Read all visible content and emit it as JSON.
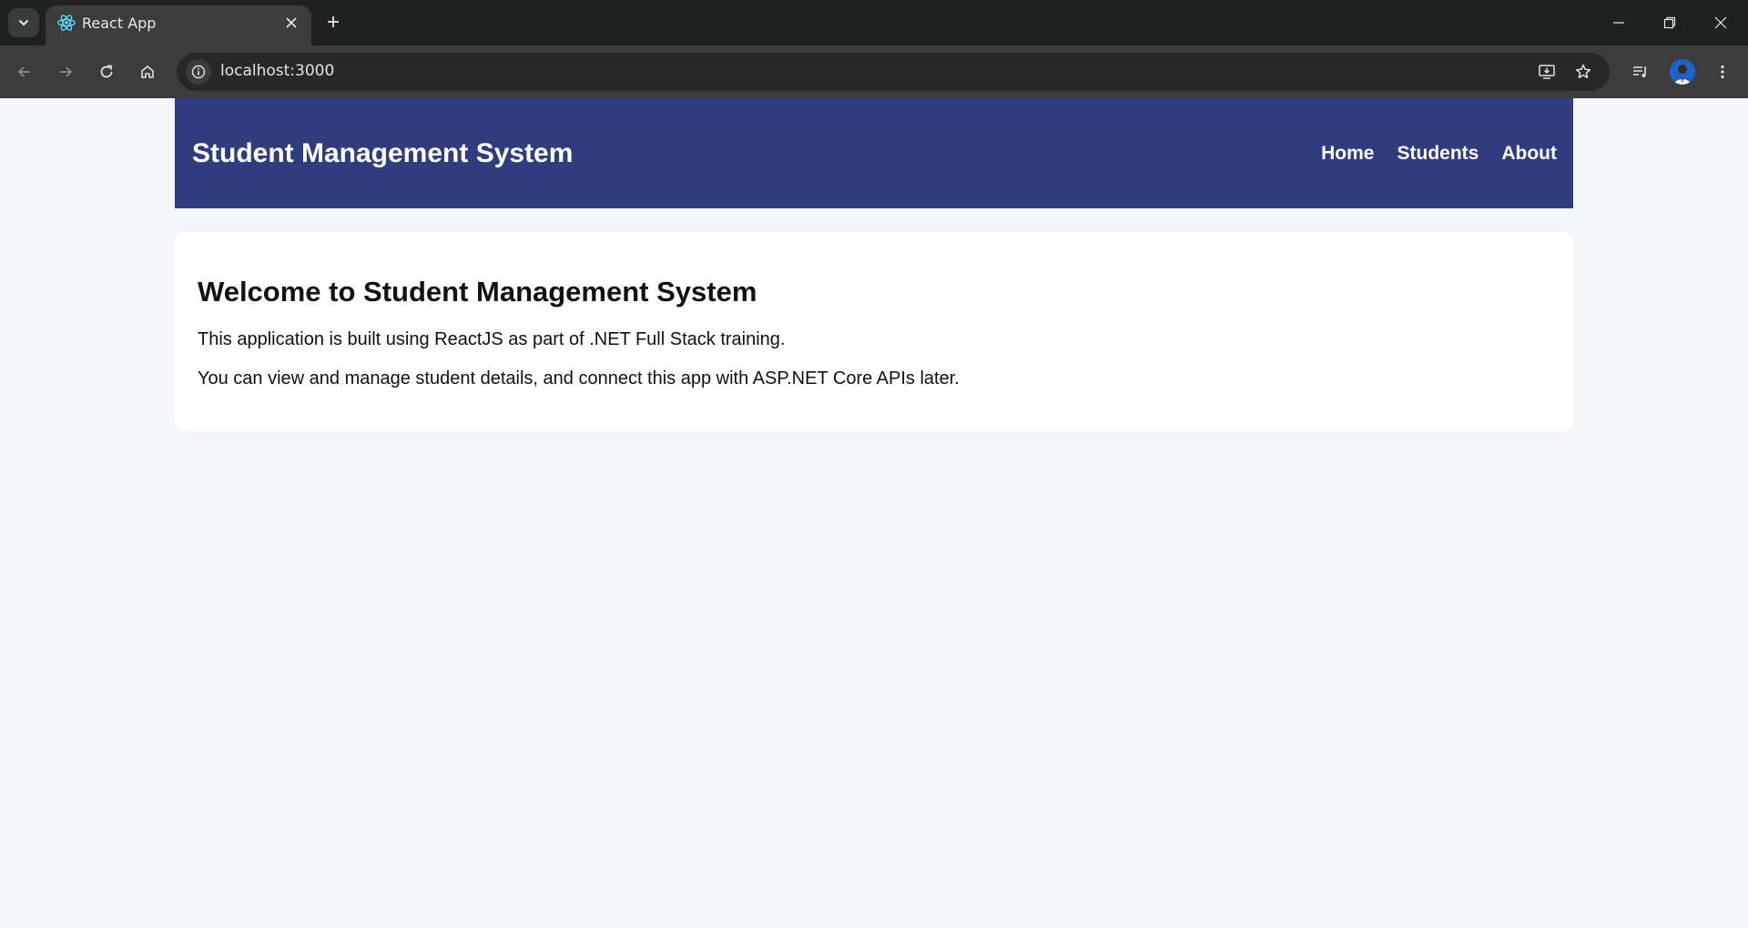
{
  "browser": {
    "tab_title": "React App",
    "url": "localhost:3000"
  },
  "app": {
    "brand": "Student Management System",
    "nav": [
      {
        "label": "Home"
      },
      {
        "label": "Students"
      },
      {
        "label": "About"
      }
    ],
    "colors": {
      "navbar": "#2f3c7e",
      "page_bg": "#f5f6fa",
      "card_bg": "#ffffff"
    }
  },
  "main": {
    "heading": "Welcome to Student Management System",
    "paragraphs": [
      "This application is built using ReactJS as part of .NET Full Stack training.",
      "You can view and manage student details, and connect this app with ASP.NET Core APIs later."
    ]
  }
}
